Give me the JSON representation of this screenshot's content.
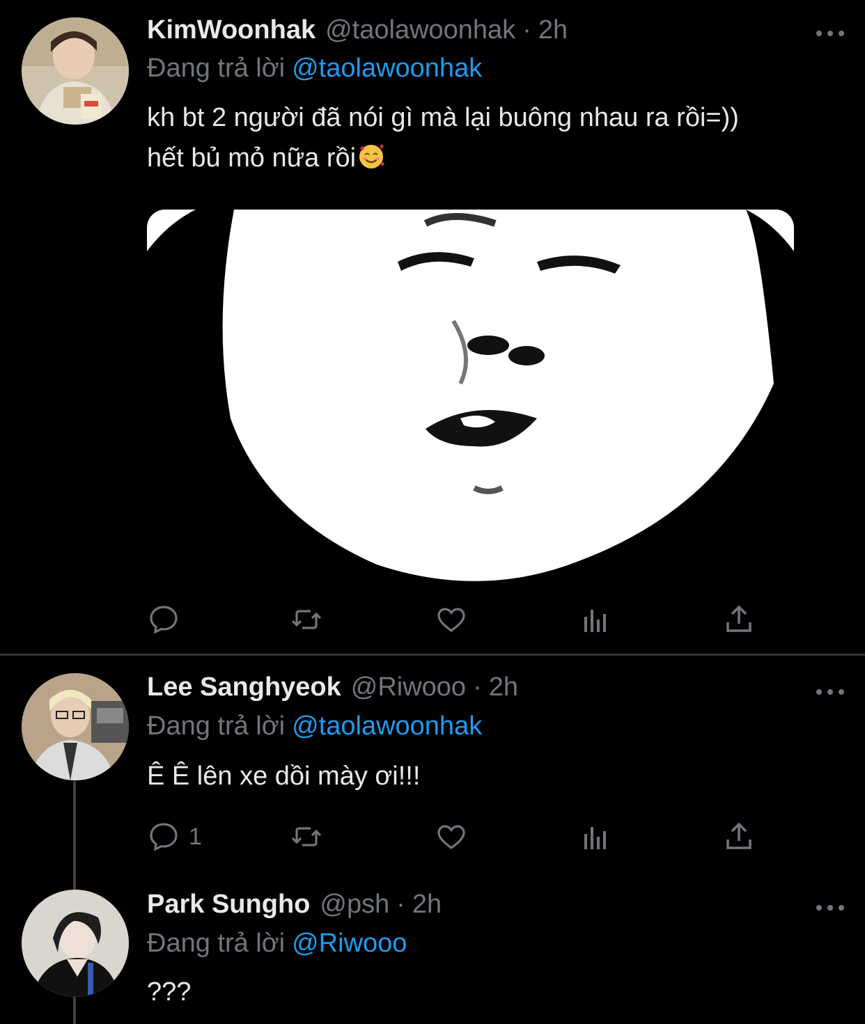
{
  "tweets": [
    {
      "name": "KimWoonhak",
      "handle": "@taolawoonhak",
      "separator": "·",
      "time": "2h",
      "replying_label": "Đang trả lời",
      "replying_to": "@taolawoonhak",
      "text_line1": "kh bt 2 người đã nói gì mà lại buông nhau ra rồi=))",
      "text_line2": "hết bủ mỏ nữa rồi",
      "emoji": "smiling-face-with-hearts-icon"
    },
    {
      "name": "Lee Sanghyeok",
      "handle": "@Riwooo",
      "separator": "·",
      "time": "2h",
      "replying_label": "Đang trả lời",
      "replying_to": "@taolawoonhak",
      "text_line1": "Ê Ê lên xe dồi mày ơi!!!",
      "reply_count": "1"
    },
    {
      "name": "Park Sungho",
      "handle": "@psh",
      "separator": "·",
      "time": "2h",
      "replying_label": "Đang trả lời",
      "replying_to": "@Riwooo",
      "text_line1": "???"
    }
  ],
  "icons": {
    "reply": "reply-icon",
    "retweet": "retweet-icon",
    "like": "heart-icon",
    "analytics": "analytics-icon",
    "share": "share-icon",
    "more": "more-icon"
  },
  "colors": {
    "background": "#000000",
    "text": "#e7e9ea",
    "muted": "#71767b",
    "accent": "#1d9bf0",
    "divider": "#2f3336"
  }
}
